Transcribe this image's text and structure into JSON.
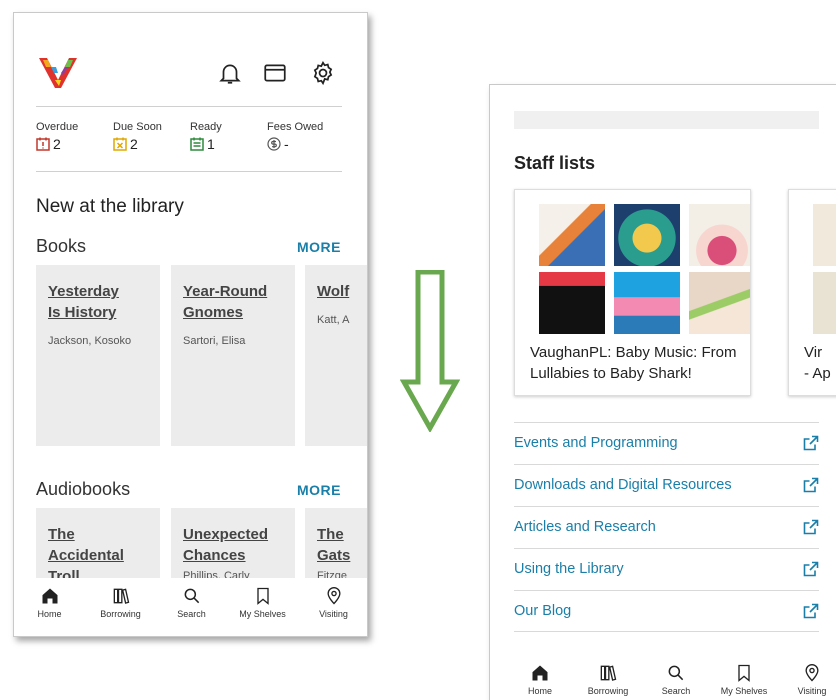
{
  "screen1": {
    "stats": [
      {
        "label": "Overdue",
        "value": "2",
        "icon": "overdue-icon",
        "color": "#c0392b"
      },
      {
        "label": "Due Soon",
        "value": "2",
        "icon": "due-soon-icon",
        "color": "#e0a800"
      },
      {
        "label": "Ready",
        "value": "1",
        "icon": "ready-icon",
        "color": "#2e8b3d"
      },
      {
        "label": "Fees Owed",
        "value": "-",
        "icon": "dollar-icon",
        "color": "#555555"
      }
    ],
    "section_title": "New at the library",
    "books": {
      "title": "Books",
      "more": "MORE",
      "cards": [
        {
          "title": "Yesterday\nIs History",
          "author": "Jackson, Kosoko"
        },
        {
          "title": "Year-Round\nGnomes",
          "author": "Sartori, Elisa"
        },
        {
          "title": "Wolf",
          "author": "Katt, A"
        }
      ]
    },
    "audiobooks": {
      "title": "Audiobooks",
      "more": "MORE",
      "cards": [
        {
          "title": "The\nAccidental\nTroll",
          "author": ""
        },
        {
          "title": "Unexpected\nChances",
          "author": "Phillips, Carly"
        },
        {
          "title": "The\nGats",
          "author": "Fitzge"
        }
      ]
    }
  },
  "tabs": [
    "Home",
    "Borrowing",
    "Search",
    "My Shelves",
    "Visiting"
  ],
  "screen2": {
    "staff_title": "Staff lists",
    "list_caption": "VaughanPL: Baby Music: From\nLullabies to Baby Shark!",
    "partial_caption": "Vir\n- Ap",
    "links": [
      "Events and Programming",
      "Downloads and Digital Resources",
      "Articles and Research",
      "Using the Library",
      "Our Blog"
    ]
  },
  "colors": {
    "accent": "#1a7fa8",
    "arrow": "#6aa84f"
  }
}
